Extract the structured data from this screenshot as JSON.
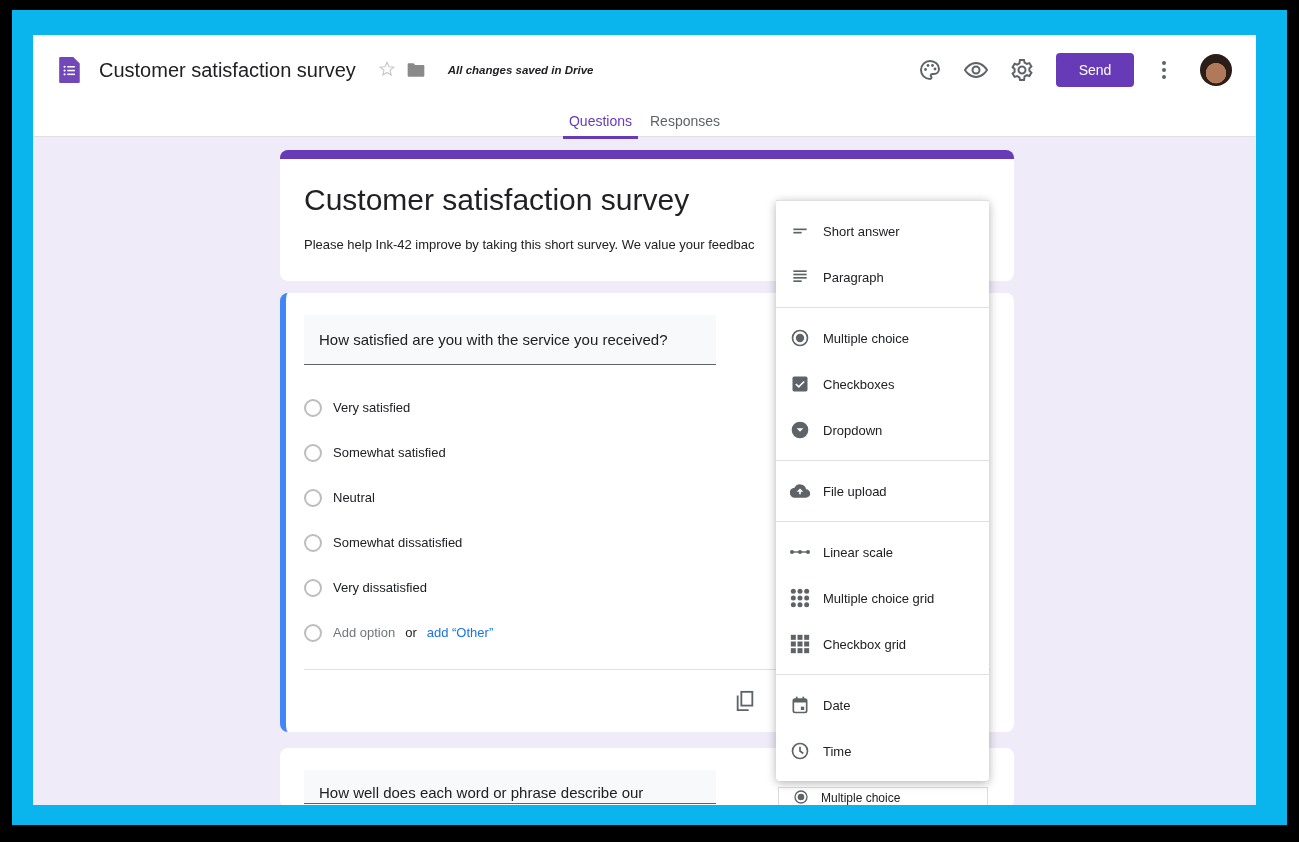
{
  "app": {
    "title": "Customer satisfaction survey",
    "starred": false,
    "save_status": "All changes saved in Drive",
    "send_button": "Send"
  },
  "tabs": [
    {
      "label": "Questions",
      "selected": true
    },
    {
      "label": "Responses",
      "selected": false
    }
  ],
  "form": {
    "title": "Customer satisfaction survey",
    "description": "Please help Ink-42 improve by taking this short survey. We value your feedbac"
  },
  "questions": [
    {
      "title": "How satisfied are you with the service you received?",
      "active": true,
      "options": [
        {
          "label": "Very satisfied",
          "checked": false
        },
        {
          "label": "Somewhat satisfied",
          "checked": false
        },
        {
          "label": "Neutral",
          "checked": false
        },
        {
          "label": "Somewhat dissatisfied",
          "checked": false
        },
        {
          "label": "Very dissatisfied",
          "checked": false
        }
      ],
      "add_option": "Add option",
      "or": "or",
      "add_other": "add “Other”"
    },
    {
      "title": "How well does each word or phrase describe our",
      "active": false,
      "type_label": "Multiple choice"
    }
  ],
  "type_menu": {
    "groups": [
      [
        {
          "kind": "short",
          "label": "Short answer"
        },
        {
          "kind": "paragraph",
          "label": "Paragraph"
        }
      ],
      [
        {
          "kind": "radio",
          "label": "Multiple choice"
        },
        {
          "kind": "checkbox",
          "label": "Checkboxes"
        },
        {
          "kind": "dropdown",
          "label": "Dropdown"
        }
      ],
      [
        {
          "kind": "upload",
          "label": "File upload"
        }
      ],
      [
        {
          "kind": "scale",
          "label": "Linear scale"
        },
        {
          "kind": "radiogrid",
          "label": "Multiple choice grid"
        },
        {
          "kind": "checkgrid",
          "label": "Checkbox grid"
        }
      ],
      [
        {
          "kind": "date",
          "label": "Date"
        },
        {
          "kind": "time",
          "label": "Time"
        }
      ]
    ]
  }
}
